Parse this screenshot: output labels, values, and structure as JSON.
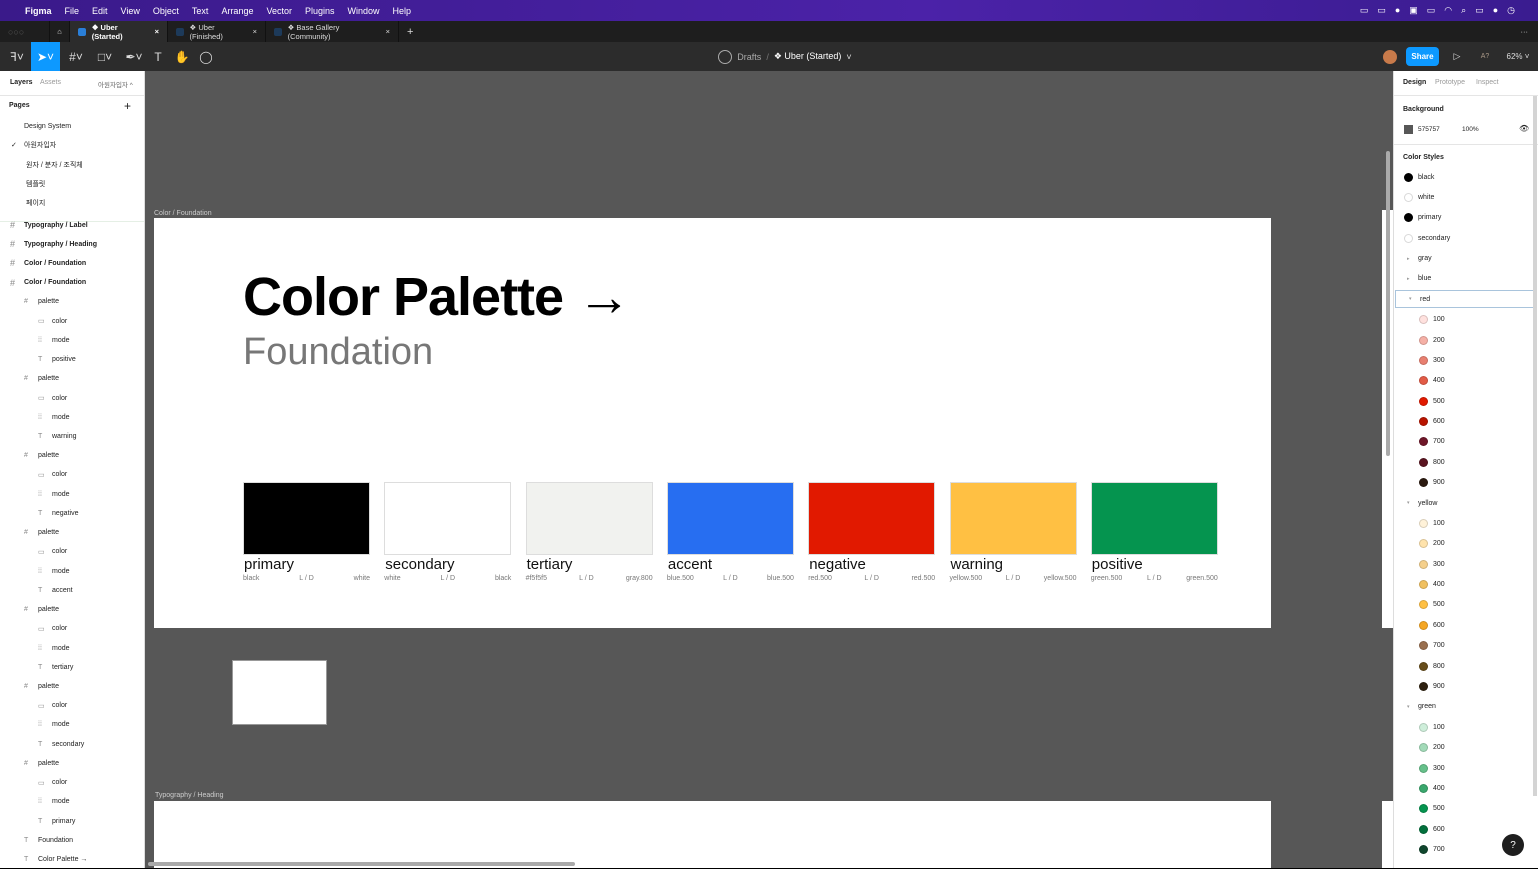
{
  "menubar": {
    "app": "Figma",
    "items": [
      "File",
      "Edit",
      "View",
      "Object",
      "Text",
      "Arrange",
      "Vector",
      "Plugins",
      "Window",
      "Help"
    ]
  },
  "tabs": [
    {
      "label": "❖ Uber (Started)",
      "active": true
    },
    {
      "label": "❖ Uber (Finished)",
      "active": false
    },
    {
      "label": "❖ Base Gallery (Community)",
      "active": false
    }
  ],
  "toolbar": {
    "breadcrumb_parent": "Drafts",
    "breadcrumb_sep": "/",
    "file_name": "❖ Uber (Started)",
    "share": "Share",
    "zoom": "62%",
    "a_label": "A?"
  },
  "left": {
    "tab_layers": "Layers",
    "tab_assets": "Assets",
    "page_dropdown": "아원자입자 ^",
    "pages_title": "Pages",
    "pages": [
      "Design System",
      "아원자입자",
      "원자 / 분자 / 조직체",
      "템플릿",
      "페이지"
    ],
    "current_page_index": 1,
    "layers": [
      {
        "label": "Typography / Label",
        "type": "frame",
        "indent": 0
      },
      {
        "label": "Typography / Heading",
        "type": "frame",
        "indent": 0
      },
      {
        "label": "Color / Foundation",
        "type": "frame",
        "indent": 0
      },
      {
        "label": "Color / Foundation",
        "type": "frame",
        "indent": 0
      },
      {
        "label": "palette",
        "type": "frame",
        "indent": 1
      },
      {
        "label": "color",
        "type": "rect",
        "indent": 2
      },
      {
        "label": "mode",
        "type": "comp",
        "indent": 2
      },
      {
        "label": "positive",
        "type": "text",
        "indent": 2
      },
      {
        "label": "palette",
        "type": "frame",
        "indent": 1
      },
      {
        "label": "color",
        "type": "rect",
        "indent": 2
      },
      {
        "label": "mode",
        "type": "comp",
        "indent": 2
      },
      {
        "label": "warning",
        "type": "text",
        "indent": 2
      },
      {
        "label": "palette",
        "type": "frame",
        "indent": 1
      },
      {
        "label": "color",
        "type": "rect",
        "indent": 2
      },
      {
        "label": "mode",
        "type": "comp",
        "indent": 2
      },
      {
        "label": "negative",
        "type": "text",
        "indent": 2
      },
      {
        "label": "palette",
        "type": "frame",
        "indent": 1
      },
      {
        "label": "color",
        "type": "rect",
        "indent": 2
      },
      {
        "label": "mode",
        "type": "comp",
        "indent": 2
      },
      {
        "label": "accent",
        "type": "text",
        "indent": 2
      },
      {
        "label": "palette",
        "type": "frame",
        "indent": 1
      },
      {
        "label": "color",
        "type": "rect",
        "indent": 2
      },
      {
        "label": "mode",
        "type": "comp",
        "indent": 2
      },
      {
        "label": "tertiary",
        "type": "text",
        "indent": 2
      },
      {
        "label": "palette",
        "type": "frame",
        "indent": 1
      },
      {
        "label": "color",
        "type": "rect",
        "indent": 2
      },
      {
        "label": "mode",
        "type": "comp",
        "indent": 2
      },
      {
        "label": "secondary",
        "type": "text",
        "indent": 2
      },
      {
        "label": "palette",
        "type": "frame",
        "indent": 1
      },
      {
        "label": "color",
        "type": "rect",
        "indent": 2
      },
      {
        "label": "mode",
        "type": "comp",
        "indent": 2
      },
      {
        "label": "primary",
        "type": "text",
        "indent": 2
      },
      {
        "label": "Foundation",
        "type": "text",
        "indent": 1
      },
      {
        "label": "Color Palette →",
        "type": "text",
        "indent": 1
      }
    ]
  },
  "canvas": {
    "frame_label": "Color / Foundation",
    "frame2_label": "Typography / Heading",
    "title": "Color Palette →",
    "subtitle": "Foundation",
    "swatches": [
      {
        "name": "primary",
        "color": "#000000",
        "left": "black",
        "mid": "L / D",
        "right": "white"
      },
      {
        "name": "secondary",
        "color": "#ffffff",
        "left": "white",
        "mid": "L / D",
        "right": "black"
      },
      {
        "name": "tertiary",
        "color": "#f1f2ef",
        "left": "#f5f5f5",
        "mid": "L / D",
        "right": "gray.800"
      },
      {
        "name": "accent",
        "color": "#276ef1",
        "left": "blue.500",
        "mid": "L / D",
        "right": "blue.500"
      },
      {
        "name": "negative",
        "color": "#e11900",
        "left": "red.500",
        "mid": "L / D",
        "right": "red.500"
      },
      {
        "name": "warning",
        "color": "#ffc043",
        "left": "yellow.500",
        "mid": "L / D",
        "right": "yellow.500"
      },
      {
        "name": "positive",
        "color": "#05944f",
        "left": "green.500",
        "mid": "L / D",
        "right": "green.500"
      }
    ]
  },
  "right": {
    "tabs": [
      "Design",
      "Prototype",
      "Inspect"
    ],
    "background_title": "Background",
    "bg_hex": "575757",
    "bg_opacity": "100%",
    "bg_color": "#575757",
    "styles_title": "Color Styles",
    "styles": [
      {
        "label": "black",
        "color": "#000000"
      },
      {
        "label": "white",
        "color": "#ffffff"
      },
      {
        "label": "primary",
        "color": "#000000"
      },
      {
        "label": "secondary",
        "color": "#ffffff"
      },
      {
        "label": "gray",
        "group": "collapsed"
      },
      {
        "label": "blue",
        "group": "collapsed"
      },
      {
        "label": "red",
        "group": "expanded",
        "selected": true
      },
      {
        "label": "100",
        "color": "#ffe1de",
        "sub": true
      },
      {
        "label": "200",
        "color": "#f5b0a6",
        "sub": true
      },
      {
        "label": "300",
        "color": "#e87f70",
        "sub": true
      },
      {
        "label": "400",
        "color": "#e25b46",
        "sub": true
      },
      {
        "label": "500",
        "color": "#e11900",
        "sub": true
      },
      {
        "label": "600",
        "color": "#b81400",
        "sub": true
      },
      {
        "label": "700",
        "color": "#6e1628",
        "sub": true
      },
      {
        "label": "800",
        "color": "#5a1420",
        "sub": true
      },
      {
        "label": "900",
        "color": "#2b1a10",
        "sub": true
      },
      {
        "label": "yellow",
        "group": "expanded"
      },
      {
        "label": "100",
        "color": "#fff2d9",
        "sub": true
      },
      {
        "label": "200",
        "color": "#ffe3ac",
        "sub": true
      },
      {
        "label": "300",
        "color": "#f5d08c",
        "sub": true
      },
      {
        "label": "400",
        "color": "#f0c060",
        "sub": true
      },
      {
        "label": "500",
        "color": "#ffc043",
        "sub": true
      },
      {
        "label": "600",
        "color": "#f5a623",
        "sub": true
      },
      {
        "label": "700",
        "color": "#996f4f",
        "sub": true
      },
      {
        "label": "800",
        "color": "#674d1b",
        "sub": true
      },
      {
        "label": "900",
        "color": "#2e2110",
        "sub": true
      },
      {
        "label": "green",
        "group": "expanded"
      },
      {
        "label": "100",
        "color": "#ceeeda",
        "sub": true
      },
      {
        "label": "200",
        "color": "#a2dab8",
        "sub": true
      },
      {
        "label": "300",
        "color": "#66c08a",
        "sub": true
      },
      {
        "label": "400",
        "color": "#3aa76d",
        "sub": true
      },
      {
        "label": "500",
        "color": "#05944f",
        "sub": true
      },
      {
        "label": "600",
        "color": "#03703c",
        "sub": true
      },
      {
        "label": "700",
        "color": "#10462d",
        "sub": true
      }
    ]
  },
  "help": "?"
}
